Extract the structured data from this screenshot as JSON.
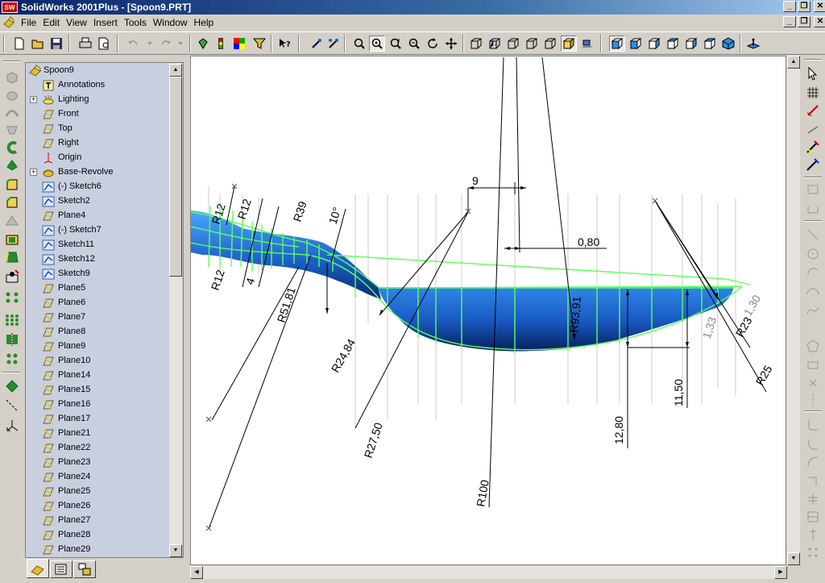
{
  "window": {
    "title": "SolidWorks 2001Plus - [Spoon9.PRT]",
    "logo_text": "SW"
  },
  "menu": [
    "File",
    "Edit",
    "View",
    "Insert",
    "Tools",
    "Window",
    "Help"
  ],
  "window_buttons": {
    "minimize": "_",
    "restore": "❐",
    "close": "✕"
  },
  "tree": {
    "root": "Spoon9",
    "items": [
      {
        "label": "Annotations",
        "icon": "annotations-icon",
        "expander": ""
      },
      {
        "label": "Lighting",
        "icon": "lighting-icon",
        "expander": "+"
      },
      {
        "label": "Front",
        "icon": "plane-icon",
        "expander": ""
      },
      {
        "label": "Top",
        "icon": "plane-icon",
        "expander": ""
      },
      {
        "label": "Right",
        "icon": "plane-icon",
        "expander": ""
      },
      {
        "label": "Origin",
        "icon": "origin-icon",
        "expander": ""
      },
      {
        "label": "Base-Revolve",
        "icon": "revolve-icon",
        "expander": "+"
      },
      {
        "label": "(-) Sketch6",
        "icon": "sketch-icon",
        "expander": ""
      },
      {
        "label": "Sketch2",
        "icon": "sketch-icon",
        "expander": ""
      },
      {
        "label": "Plane4",
        "icon": "plane-icon",
        "expander": ""
      },
      {
        "label": "(-) Sketch7",
        "icon": "sketch-icon",
        "expander": ""
      },
      {
        "label": "Sketch11",
        "icon": "sketch-icon",
        "expander": ""
      },
      {
        "label": "Sketch12",
        "icon": "sketch-icon",
        "expander": ""
      },
      {
        "label": "Sketch9",
        "icon": "sketch-icon",
        "expander": ""
      },
      {
        "label": "Plane5",
        "icon": "plane-icon",
        "expander": ""
      },
      {
        "label": "Plane6",
        "icon": "plane-icon",
        "expander": ""
      },
      {
        "label": "Plane7",
        "icon": "plane-icon",
        "expander": ""
      },
      {
        "label": "Plane8",
        "icon": "plane-icon",
        "expander": ""
      },
      {
        "label": "Plane9",
        "icon": "plane-icon",
        "expander": ""
      },
      {
        "label": "Plane10",
        "icon": "plane-icon",
        "expander": ""
      },
      {
        "label": "Plane14",
        "icon": "plane-icon",
        "expander": ""
      },
      {
        "label": "Plane15",
        "icon": "plane-icon",
        "expander": ""
      },
      {
        "label": "Plane16",
        "icon": "plane-icon",
        "expander": ""
      },
      {
        "label": "Plane17",
        "icon": "plane-icon",
        "expander": ""
      },
      {
        "label": "Plane21",
        "icon": "plane-icon",
        "expander": ""
      },
      {
        "label": "Plane22",
        "icon": "plane-icon",
        "expander": ""
      },
      {
        "label": "Plane23",
        "icon": "plane-icon",
        "expander": ""
      },
      {
        "label": "Plane24",
        "icon": "plane-icon",
        "expander": ""
      },
      {
        "label": "Plane25",
        "icon": "plane-icon",
        "expander": ""
      },
      {
        "label": "Plane26",
        "icon": "plane-icon",
        "expander": ""
      },
      {
        "label": "Plane27",
        "icon": "plane-icon",
        "expander": ""
      },
      {
        "label": "Plane28",
        "icon": "plane-icon",
        "expander": ""
      },
      {
        "label": "Plane29",
        "icon": "plane-icon",
        "expander": ""
      }
    ]
  },
  "dimensions": [
    "9",
    "0,80",
    "R12",
    "R12",
    "R39",
    "10°",
    "R12",
    "4",
    "R51,81",
    "R24,84",
    "R27,50",
    "R100",
    "R93,91",
    "12,80",
    "11,50",
    "1,33",
    "1,30",
    "R23",
    "R25"
  ],
  "colors": {
    "titlebar_start": "#0a246a",
    "titlebar_end": "#a6caf0",
    "face": "#d4d0c8",
    "tree_bg": "#c8d0e0",
    "model_blue": "#1f63c8",
    "sketch_green": "#5dff5d"
  }
}
